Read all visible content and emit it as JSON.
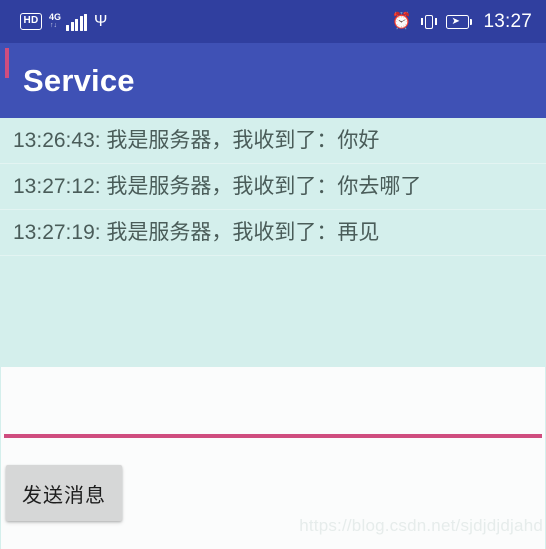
{
  "status_bar": {
    "hd_badge": "HD",
    "network_label": "4G",
    "network_sub": "↑↓",
    "usb_icon": "Ψ",
    "alarm_icon": "⏰",
    "time": "13:27",
    "icons": [
      "hd-badge-icon",
      "signal-bars-icon",
      "usb-icon",
      "alarm-clock-icon",
      "vibrate-icon",
      "battery-charging-icon"
    ],
    "background_color": "#303f9f"
  },
  "app_bar": {
    "title": "Service",
    "background_color": "#3f51b5",
    "title_color": "#ffffff"
  },
  "message_list": {
    "background_color": "#d4efec",
    "text_color": "#4a5c59",
    "messages": [
      {
        "text": "13:26:43: 我是服务器，我收到了：你好"
      },
      {
        "text": "13:27:12: 我是服务器，我收到了：你去哪了"
      },
      {
        "text": "13:27:19: 我是服务器，我收到了：再见"
      }
    ]
  },
  "input_panel": {
    "input_value": "",
    "input_placeholder": "",
    "underline_color": "#cf4d7f",
    "cursor_color": "#cf4d7f",
    "background_color": "#fbfcfc"
  },
  "send_button": {
    "label": "发送消息",
    "background_color": "#d6d7d7",
    "text_color": "#1d1d1d"
  },
  "watermark": {
    "text": "https://blog.csdn.net/sjdjdjdjahd",
    "color": "#e6eceb"
  }
}
